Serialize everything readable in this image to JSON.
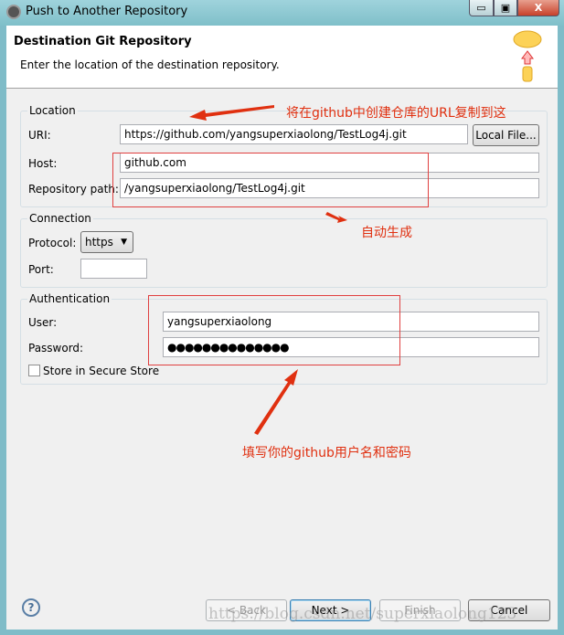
{
  "window": {
    "title": "Push to Another Repository",
    "minimize": "▭",
    "maximize": "▣",
    "close": "X"
  },
  "header": {
    "title": "Destination Git Repository",
    "description": "Enter the location of the destination repository."
  },
  "location": {
    "group_label": "Location",
    "uri_label": "URI:",
    "uri_value": "https://github.com/yangsuperxiaolong/TestLog4j.git",
    "local_file_button": "Local File...",
    "host_label": "Host:",
    "host_value": "github.com",
    "repo_path_label": "Repository path:",
    "repo_path_value": "/yangsuperxiaolong/TestLog4j.git"
  },
  "connection": {
    "group_label": "Connection",
    "protocol_label": "Protocol:",
    "protocol_value": "https",
    "port_label": "Port:",
    "port_value": ""
  },
  "authentication": {
    "group_label": "Authentication",
    "user_label": "User:",
    "user_value": "yangsuperxiaolong",
    "password_label": "Password:",
    "password_value": "●●●●●●●●●●●●●●",
    "store_label": "Store in Secure Store",
    "store_checked": false
  },
  "annotations": {
    "uri_note": "将在github中创建仓库的URL复制到这",
    "auto_note": "自动生成",
    "credentials_note": "填写你的github用户名和密码",
    "color": "#e03010"
  },
  "footer": {
    "help": "?",
    "back": "< Back",
    "next": "Next >",
    "finish": "Finish",
    "cancel": "Cancel"
  },
  "watermark": "https://blog.csdn.net/superxiaolong123"
}
